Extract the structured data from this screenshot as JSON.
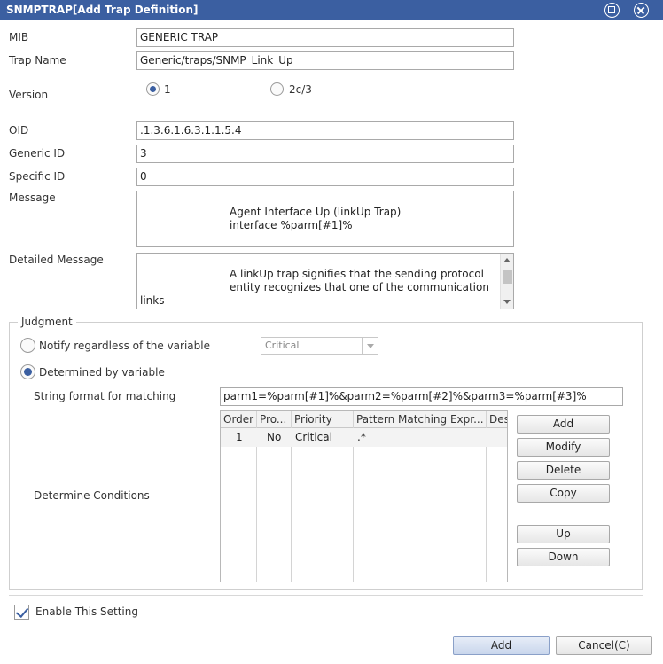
{
  "window": {
    "title": "SNMPTRAP[Add Trap Definition]"
  },
  "form": {
    "mib_label": "MIB",
    "mib_value": "GENERIC TRAP",
    "trap_name_label": "Trap Name",
    "trap_name_value": "Generic/traps/SNMP_Link_Up",
    "version_label": "Version",
    "version_options": [
      "1",
      "2c/3"
    ],
    "version_selected": "1",
    "oid_label": "OID",
    "oid_value": ".1.3.6.1.6.3.1.1.5.4",
    "generic_id_label": "Generic ID",
    "generic_id_value": "3",
    "specific_id_label": "Specific ID",
    "specific_id_value": "0",
    "message_label": "Message",
    "message_lines": [
      "Agent Interface Up (linkUp Trap)",
      "interface %parm[#1]%"
    ],
    "detailed_label": "Detailed Message",
    "detailed_lines": [
      "A linkUp trap signifies that the sending protocol",
      "entity recognizes that one of the communication",
      "links"
    ]
  },
  "judgment": {
    "legend": "Judgment",
    "notify_label": "Notify regardless of the variable",
    "notify_select": "Critical",
    "determined_label": "Determined by variable",
    "string_format_label": "String format for matching",
    "string_format_value": "parm1=%parm[#1]%&parm2=%parm[#2]%&parm3=%parm[#3]%",
    "conditions_label": "Determine Conditions",
    "table": {
      "headers": [
        "Order",
        "Pro...",
        "Priority",
        "Pattern Matching Expr...",
        "Des"
      ],
      "rows": [
        {
          "order": "1",
          "pro": "No",
          "priority": "Critical",
          "pattern": ".*",
          "des": ""
        }
      ]
    },
    "buttons": {
      "add": "Add",
      "modify": "Modify",
      "delete": "Delete",
      "copy": "Copy",
      "up": "Up",
      "down": "Down"
    }
  },
  "enable": {
    "label": "Enable This Setting",
    "checked": true
  },
  "footer": {
    "add": "Add",
    "cancel": "Cancel(C)"
  },
  "colors": {
    "titlebar": "#3b5fa1",
    "accent": "#3b5fa1"
  }
}
